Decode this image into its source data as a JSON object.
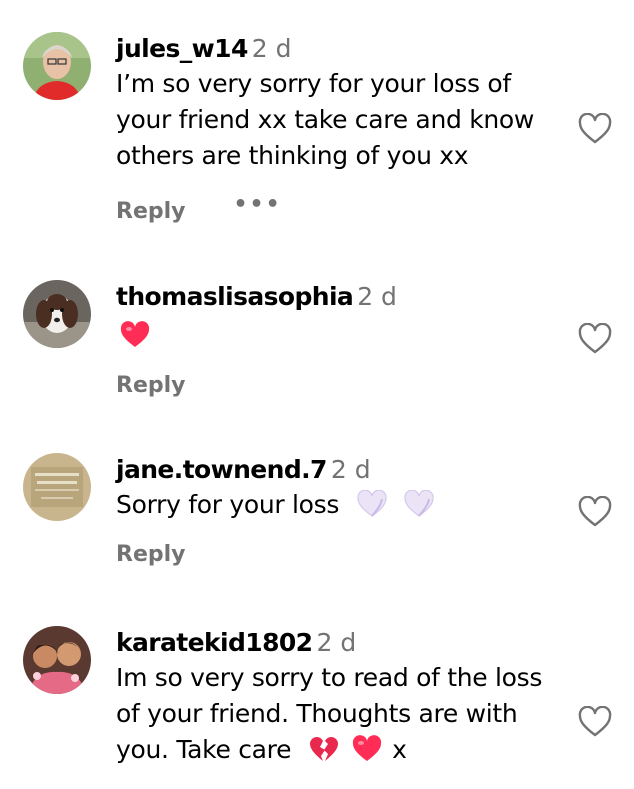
{
  "comments": [
    {
      "username": "jules_w14",
      "time": "2 d",
      "text": "I’m so very sorry for your loss of your friend xx take care and know others are thinking of you xx",
      "reply_label": "Reply",
      "more_label": "•••"
    },
    {
      "username": "thomaslisasophia",
      "time": "2 d",
      "text": "",
      "emoji": "red-heart",
      "reply_label": "Reply"
    },
    {
      "username": "jane.townend.7",
      "time": "2 d",
      "text": "Sorry for your loss",
      "emoji": "white-heart",
      "reply_label": "Reply"
    },
    {
      "username": "karatekid1802",
      "time": "2 d",
      "text_line1": "Im so very sorry to read of the loss",
      "text_line2": "of your friend. Thoughts are with",
      "text_line3_prefix": "you. Take care",
      "text_line3_suffix": "x",
      "emoji_broken": "broken-heart",
      "emoji_heart": "red-heart"
    }
  ],
  "colors": {
    "secondary_text": "#737373",
    "heart_red": "#ff2d55",
    "like_outline": "#737373"
  }
}
